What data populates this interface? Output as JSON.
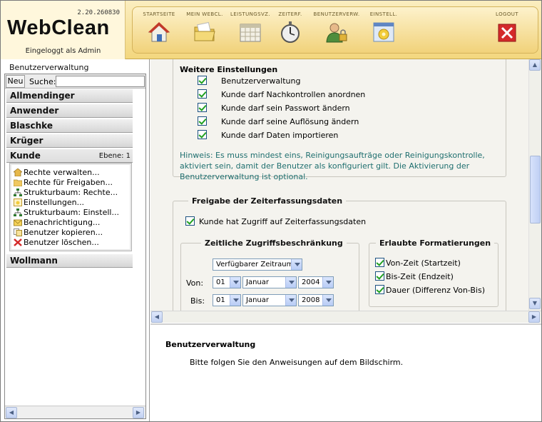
{
  "header": {
    "version": "2.20.260830",
    "brand": "WebClean",
    "login_text": "Eingeloggt als Admin",
    "nav": [
      {
        "label": "STARTSEITE",
        "icon": "house-icon"
      },
      {
        "label": "MEIN WEBCL.",
        "icon": "folder-icon"
      },
      {
        "label": "LEISTUNGSVZ.",
        "icon": "calendar-icon"
      },
      {
        "label": "ZEITERF.",
        "icon": "stopwatch-icon"
      },
      {
        "label": "BENUTZERVERW.",
        "icon": "user-lock-icon"
      },
      {
        "label": "EINSTELL.",
        "icon": "settings-window-icon"
      },
      {
        "label": "LOGOUT",
        "icon": "close-icon"
      }
    ]
  },
  "sidebar": {
    "title": "Benutzerverwaltung",
    "new_label": "Neu",
    "search_label": "Suche:",
    "search_value": "",
    "groups": [
      "Allmendinger",
      "Anwender",
      "Blaschke",
      "Krüger",
      "Kunde",
      "Wollmann"
    ],
    "expanded_group": "Kunde",
    "level_label": "Ebene: 1",
    "menu_items": [
      {
        "label": "Rechte verwalten...",
        "icon": "key-house-icon"
      },
      {
        "label": "Rechte für Freigaben...",
        "icon": "folder-hand-icon"
      },
      {
        "label": "Strukturbaum: Rechte...",
        "icon": "tree-icon"
      },
      {
        "label": "Einstellungen...",
        "icon": "settings-icon"
      },
      {
        "label": "Strukturbaum: Einstell...",
        "icon": "tree-icon"
      },
      {
        "label": "Benachrichtigung...",
        "icon": "envelope-icon"
      },
      {
        "label": "Benutzer kopieren...",
        "icon": "copy-user-icon"
      },
      {
        "label": "Benutzer löschen...",
        "icon": "red-x-icon"
      }
    ]
  },
  "main": {
    "weitere": {
      "title": "Weitere Einstellungen",
      "options": [
        {
          "label": "Benutzerverwaltung",
          "checked": true
        },
        {
          "label": "Kunde darf Nachkontrollen anordnen",
          "checked": true
        },
        {
          "label": "Kunde darf sein Passwort ändern",
          "checked": true
        },
        {
          "label": "Kunde darf seine Auflösung ändern",
          "checked": true
        },
        {
          "label": "Kunde darf Daten importieren",
          "checked": true
        }
      ],
      "hint": "Hinweis: Es muss mindest eins, Reinigungsaufträge oder Reinigungskontrolle, aktiviert sein, damit der Benutzer als konfiguriert gilt. Die Aktivierung der Benutzerverwaltung ist optional."
    },
    "freigabe": {
      "title": "Freigabe der Zeiterfassungsdaten",
      "access_label": "Kunde hat Zugriff auf Zeiterfassungsdaten",
      "access_checked": true,
      "zeitlich": {
        "title": "Zeitliche Zugriffsbeschränkung",
        "mode": "Verfügbarer Zeitraum",
        "von_label": "Von:",
        "bis_label": "Bis:",
        "von": {
          "day": "01",
          "month": "Januar",
          "year": "2004"
        },
        "bis": {
          "day": "01",
          "month": "Januar",
          "year": "2008"
        }
      },
      "formatierungen": {
        "title": "Erlaubte Formatierungen",
        "options": [
          {
            "label": "Von-Zeit (Startzeit)",
            "checked": true
          },
          {
            "label": "Bis-Zeit (Endzeit)",
            "checked": true
          },
          {
            "label": "Dauer (Differenz Von-Bis)",
            "checked": true
          }
        ]
      }
    }
  },
  "info": {
    "title": "Benutzerverwaltung",
    "text": "Bitte folgen Sie den Anweisungen auf dem Bildschirm."
  },
  "colors": {
    "header_gold": "#f3d77e",
    "hint_text": "#1f6f6f",
    "check_green": "#21a121",
    "logout_red": "#d42a2a"
  }
}
